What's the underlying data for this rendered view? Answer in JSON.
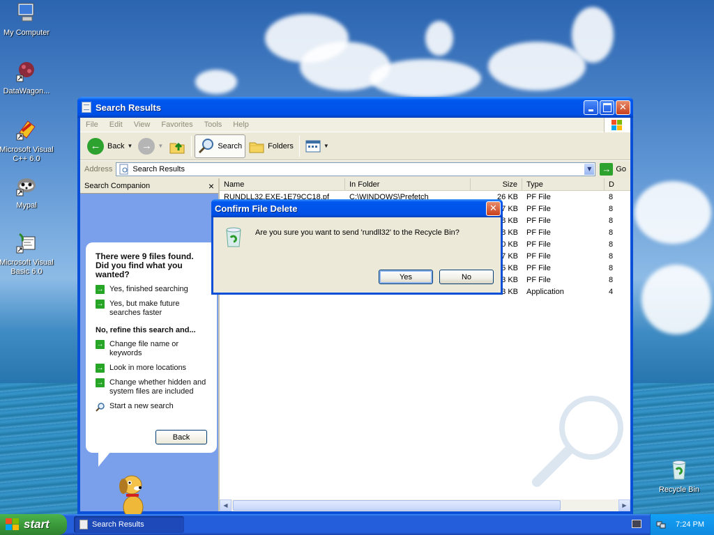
{
  "desktop": {
    "icons": [
      {
        "label": "My Computer"
      },
      {
        "label": "DataWagon..."
      },
      {
        "label": "Microsoft Visual C++ 6.0"
      },
      {
        "label": "Mypal"
      },
      {
        "label": "Microsoft Visual Basic 6.0"
      },
      {
        "label": "Recycle Bin"
      }
    ]
  },
  "window": {
    "title": "Search Results",
    "menu": [
      "File",
      "Edit",
      "View",
      "Favorites",
      "Tools",
      "Help"
    ],
    "toolbar": {
      "back": "Back",
      "search": "Search",
      "folders": "Folders"
    },
    "address": {
      "label": "Address",
      "value": "Search Results",
      "go": "Go"
    },
    "companion": {
      "title": "Search Companion",
      "close": "×",
      "heading": "There were 9 files found. Did you find what you wanted?",
      "yes_options": [
        "Yes, finished searching",
        "Yes, but make future searches faster"
      ],
      "refine_heading": "No, refine this search and...",
      "refine_options": [
        "Change file name or keywords",
        "Look in more locations",
        "Change whether hidden and system files are included"
      ],
      "new_search": "Start a new search",
      "back": "Back"
    },
    "columns": {
      "name": "Name",
      "folder": "In Folder",
      "size": "Size",
      "type": "Type",
      "extra": "D"
    },
    "rows": [
      {
        "name": "RUNDLL32.EXE-1E79CC18.pf",
        "folder": "C:\\WINDOWS\\Prefetch",
        "size": "26 KB",
        "type": "PF File",
        "extra": "8"
      },
      {
        "name": "",
        "folder": "",
        "size": "47 KB",
        "type": "PF File",
        "extra": "8"
      },
      {
        "name": "",
        "folder": "",
        "size": "58 KB",
        "type": "PF File",
        "extra": "8"
      },
      {
        "name": "",
        "folder": "",
        "size": "58 KB",
        "type": "PF File",
        "extra": "8"
      },
      {
        "name": "",
        "folder": "",
        "size": "50 KB",
        "type": "PF File",
        "extra": "8"
      },
      {
        "name": "",
        "folder": "",
        "size": "17 KB",
        "type": "PF File",
        "extra": "8"
      },
      {
        "name": "",
        "folder": "",
        "size": "25 KB",
        "type": "PF File",
        "extra": "8"
      },
      {
        "name": "",
        "folder": "",
        "size": "23 KB",
        "type": "PF File",
        "extra": "8"
      },
      {
        "name": "",
        "folder": "",
        "size": "33 KB",
        "type": "Application",
        "extra": "4"
      }
    ]
  },
  "dialog": {
    "title": "Confirm File Delete",
    "message": "Are you sure you want to send 'rundll32' to the Recycle Bin?",
    "yes": "Yes",
    "no": "No"
  },
  "taskbar": {
    "start": "start",
    "task": "Search Results",
    "clock": "7:24 PM"
  },
  "colors": {
    "title_blue": "#0058ee",
    "start_green": "#3c9a3c",
    "companion_blue": "#7aa0eb"
  }
}
